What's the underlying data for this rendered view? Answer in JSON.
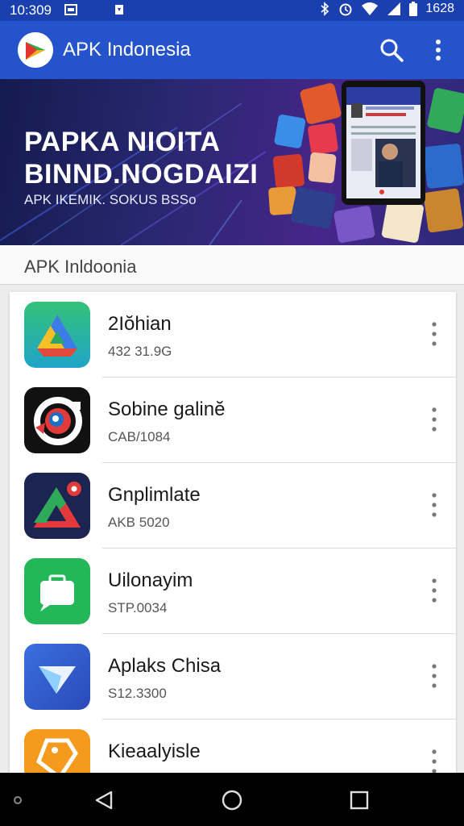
{
  "status_bar": {
    "time": "10:309",
    "clock_right": "1628",
    "icons": [
      "gallery-icon",
      "notification-icon",
      "bluetooth-icon",
      "alarm-icon",
      "wifi-icon",
      "signal-icon",
      "battery-icon"
    ]
  },
  "app_bar": {
    "title": "APK Indonesia",
    "icons": [
      "app-logo-icon",
      "search-icon",
      "more-vert-icon"
    ]
  },
  "banner": {
    "headline_line1": "PAPKA NIOITA",
    "headline_line2": "BINND.NOGDAIZI",
    "subtitle": "APK IKEMIK. SOKUS BSSo"
  },
  "section": {
    "title": "APK Inldoonia"
  },
  "apps": [
    {
      "name": "2Iŏhian",
      "meta": "432 31.9G",
      "icon": "drive-triangle-icon"
    },
    {
      "name": "Sobine galinĕ",
      "meta": "CAB/1084",
      "icon": "target-gear-icon"
    },
    {
      "name": "Gnplimlate",
      "meta": "AKB 5020",
      "icon": "red-triangle-icon"
    },
    {
      "name": "Uilonayim",
      "meta": "STP.0034",
      "icon": "green-briefcase-icon"
    },
    {
      "name": "Aplaks Chisa",
      "meta": "S12.3300",
      "icon": "blue-arrow-icon"
    },
    {
      "name": "Kieaalyisle",
      "meta": "",
      "icon": "orange-tag-icon"
    }
  ],
  "colors": {
    "status_bar": "#1a3fae",
    "app_bar": "#2453cc",
    "banner_gradient": [
      "#141b4f",
      "#46268a"
    ],
    "nav_bar": "#000000"
  },
  "nav_bar": {
    "icons": [
      "back-icon",
      "home-icon",
      "recents-icon"
    ]
  }
}
